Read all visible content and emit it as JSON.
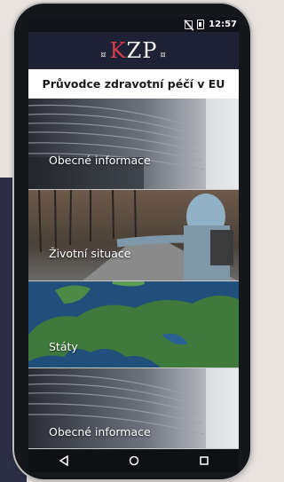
{
  "status_bar": {
    "time": "12:57"
  },
  "logo": {
    "text_k": "K",
    "text_zp": "ZP",
    "dot": "¤"
  },
  "header": {
    "title": "Průvodce zdravotní péčí v EU"
  },
  "menu": {
    "items": [
      {
        "label": "Obecné informace"
      },
      {
        "label": "Životní situace"
      },
      {
        "label": "Státy"
      },
      {
        "label": "Obecné informace"
      }
    ]
  },
  "colors": {
    "accent": "#d43d4a",
    "screen_bg": "#1f2234",
    "title_bg": "#ffffff"
  },
  "icons": {
    "nav": [
      "back-icon",
      "home-icon",
      "recents-icon"
    ]
  }
}
